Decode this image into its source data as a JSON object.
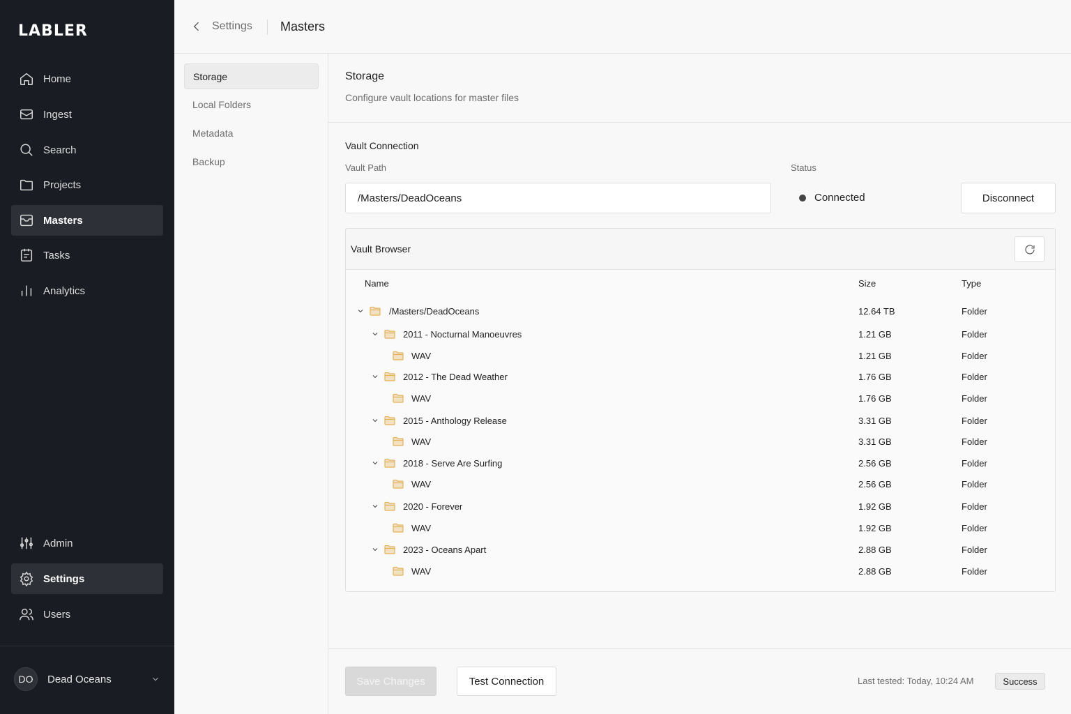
{
  "app": {
    "logo": "LABLER"
  },
  "sidebar": {
    "items": [
      {
        "label": "Home",
        "icon": "home-icon"
      },
      {
        "label": "Ingest",
        "icon": "inbox-icon"
      },
      {
        "label": "Search",
        "icon": "search-icon"
      },
      {
        "label": "Projects",
        "icon": "folder-icon"
      },
      {
        "label": "Masters",
        "icon": "archive-icon",
        "active": true
      },
      {
        "label": "Tasks",
        "icon": "clipboard-icon"
      },
      {
        "label": "Analytics",
        "icon": "bar-chart-icon"
      }
    ],
    "bottom_items": [
      {
        "label": "Admin",
        "icon": "sliders-icon"
      },
      {
        "label": "Settings",
        "icon": "gear-icon",
        "active": true
      },
      {
        "label": "Users",
        "icon": "users-icon"
      }
    ],
    "account": {
      "initials": "DO",
      "name": "Dead Oceans"
    }
  },
  "header": {
    "back": "Settings",
    "title": "Masters"
  },
  "subnav": {
    "items": [
      {
        "label": "Storage",
        "active": true
      },
      {
        "label": "Local Folders"
      },
      {
        "label": "Metadata"
      },
      {
        "label": "Backup"
      }
    ]
  },
  "storage": {
    "title": "Storage",
    "description": "Configure vault locations for master files",
    "vault_connection": {
      "title": "Vault Connection",
      "path_label": "Vault Path",
      "path_value": "/Masters/DeadOceans",
      "status_label": "Status",
      "status_value": "Connected",
      "disconnect_label": "Disconnect"
    },
    "vault_browser": {
      "title": "Vault Browser",
      "columns": {
        "name": "Name",
        "size": "Size",
        "type": "Type"
      },
      "rows": [
        {
          "name": "/Masters/DeadOceans",
          "size": "12.64 TB",
          "type": "Folder",
          "level": 0,
          "expandable": true
        },
        {
          "name": "2011 - Nocturnal Manoeuvres",
          "size": "1.21 GB",
          "type": "Folder",
          "level": 1,
          "expandable": true
        },
        {
          "name": "WAV",
          "size": "1.21 GB",
          "type": "Folder",
          "level": 2,
          "expandable": false
        },
        {
          "name": "2012 - The Dead Weather",
          "size": "1.76 GB",
          "type": "Folder",
          "level": 1,
          "expandable": true
        },
        {
          "name": "WAV",
          "size": "1.76 GB",
          "type": "Folder",
          "level": 2,
          "expandable": false
        },
        {
          "name": "2015 - Anthology Release",
          "size": "3.31 GB",
          "type": "Folder",
          "level": 1,
          "expandable": true
        },
        {
          "name": "WAV",
          "size": "3.31 GB",
          "type": "Folder",
          "level": 2,
          "expandable": false
        },
        {
          "name": "2018 - Serve Are Surfing",
          "size": "2.56 GB",
          "type": "Folder",
          "level": 1,
          "expandable": true
        },
        {
          "name": "WAV",
          "size": "2.56 GB",
          "type": "Folder",
          "level": 2,
          "expandable": false
        },
        {
          "name": "2020 - Forever",
          "size": "1.92 GB",
          "type": "Folder",
          "level": 1,
          "expandable": true
        },
        {
          "name": "WAV",
          "size": "1.92 GB",
          "type": "Folder",
          "level": 2,
          "expandable": false
        },
        {
          "name": "2023 - Oceans Apart",
          "size": "2.88 GB",
          "type": "Folder",
          "level": 1,
          "expandable": true
        },
        {
          "name": "WAV",
          "size": "2.88 GB",
          "type": "Folder",
          "level": 2,
          "expandable": false
        }
      ]
    }
  },
  "footer": {
    "save_label": "Save Changes",
    "test_label": "Test Connection",
    "last_tested": "Last tested: Today, 10:24 AM",
    "result_badge": "Success"
  },
  "colors": {
    "sidebar_bg": "#191c22",
    "sidebar_active": "#2d3036",
    "folder": "#e3b25a"
  }
}
